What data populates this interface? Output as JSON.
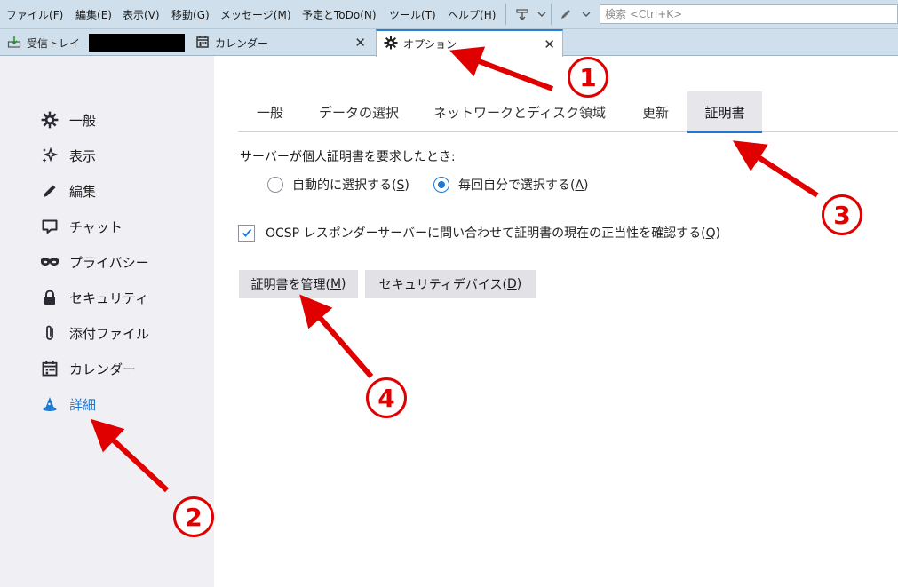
{
  "menubar": {
    "items": [
      {
        "label": "ファイル(",
        "key": "F",
        "tail": ")"
      },
      {
        "label": "編集(",
        "key": "E",
        "tail": ")"
      },
      {
        "label": "表示(",
        "key": "V",
        "tail": ")"
      },
      {
        "label": "移動(",
        "key": "G",
        "tail": ")"
      },
      {
        "label": "メッセージ(",
        "key": "M",
        "tail": ")"
      },
      {
        "label": "予定とToDo(",
        "key": "N",
        "tail": ")"
      },
      {
        "label": "ツール(",
        "key": "T",
        "tail": ")"
      },
      {
        "label": "ヘルプ(",
        "key": "H",
        "tail": ")"
      }
    ],
    "toolbar_icons": [
      "download-icon",
      "chevron-down-icon",
      "pencil-icon",
      "chevron-down-icon"
    ],
    "search_placeholder": "検索 <Ctrl+K>"
  },
  "tabs": [
    {
      "label": "受信トレイ -",
      "icon": "inbox-download-icon",
      "redacted": true
    },
    {
      "label": "カレンダー",
      "icon": "calendar-icon",
      "close": "✕"
    },
    {
      "label": "オプション",
      "icon": "gear-icon",
      "close": "✕",
      "active": true
    }
  ],
  "sidebar": {
    "items": [
      {
        "label": "一般",
        "icon": "gear-icon"
      },
      {
        "label": "表示",
        "icon": "sparkle-icon"
      },
      {
        "label": "編集",
        "icon": "pencil-icon"
      },
      {
        "label": "チャット",
        "icon": "chat-icon"
      },
      {
        "label": "プライバシー",
        "icon": "mask-icon"
      },
      {
        "label": "セキュリティ",
        "icon": "lock-icon"
      },
      {
        "label": "添付ファイル",
        "icon": "paperclip-icon"
      },
      {
        "label": "カレンダー",
        "icon": "calendar-icon"
      },
      {
        "label": "詳細",
        "icon": "wizard-hat-icon",
        "selected": true
      }
    ]
  },
  "subtabs": [
    {
      "label": "一般"
    },
    {
      "label": "データの選択"
    },
    {
      "label": "ネットワークとディスク領域"
    },
    {
      "label": "更新"
    },
    {
      "label": "証明書",
      "active": true
    }
  ],
  "certificates": {
    "prompt": "サーバーが個人証明書を要求したとき:",
    "radio_auto": {
      "label": "自動的に選択する(",
      "key": "S",
      "tail": ")",
      "checked": false
    },
    "radio_ask": {
      "label": "毎回自分で選択する(",
      "key": "A",
      "tail": ")",
      "checked": true
    },
    "ocsp": {
      "label": "OCSP レスポンダーサーバーに問い合わせて証明書の現在の正当性を確認する(",
      "key": "Q",
      "tail": ")",
      "checked": true
    },
    "manage_button": {
      "label": "証明書を管理(",
      "key": "M",
      "tail": ")"
    },
    "devices_button": {
      "label": "セキュリティデバイス(",
      "key": "D",
      "tail": ")"
    }
  },
  "annotations": {
    "color": "#e00000",
    "markers": [
      {
        "number": "1"
      },
      {
        "number": "2"
      },
      {
        "number": "3"
      },
      {
        "number": "4"
      }
    ]
  }
}
